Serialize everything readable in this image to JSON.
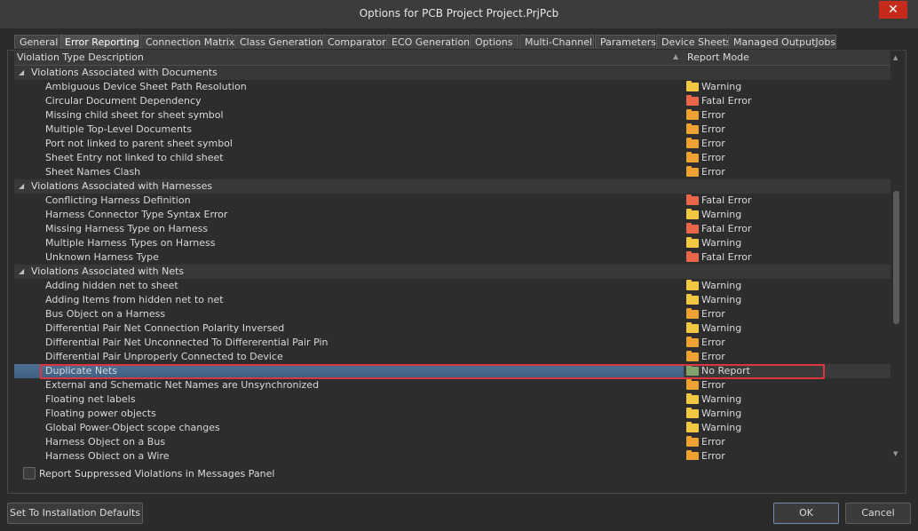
{
  "window": {
    "title": "Options for PCB Project Project.PrjPcb",
    "close_label": "✕"
  },
  "tabs": [
    {
      "label": "General",
      "width": 50
    },
    {
      "label": "Error Reporting",
      "width": 90,
      "active": true
    },
    {
      "label": "Connection Matrix",
      "width": 105
    },
    {
      "label": "Class Generation",
      "width": 98
    },
    {
      "label": "Comparator",
      "width": 71
    },
    {
      "label": "ECO Generation",
      "width": 93
    },
    {
      "label": "Options",
      "width": 55
    },
    {
      "label": "Multi-Channel",
      "width": 84
    },
    {
      "label": "Parameters",
      "width": 68
    },
    {
      "label": "Device Sheets",
      "width": 80
    },
    {
      "label": "Managed OutputJobs",
      "width": 122
    }
  ],
  "grid": {
    "col_description": "Violation Type Description",
    "col_mode": "Report Mode",
    "groups": [
      {
        "name": "Violations Associated with Documents",
        "items": [
          {
            "name": "Ambiguous Device Sheet Path Resolution",
            "mode": "Warning"
          },
          {
            "name": "Circular Document Dependency",
            "mode": "Fatal Error"
          },
          {
            "name": "Missing child sheet for sheet symbol",
            "mode": "Error"
          },
          {
            "name": "Multiple Top-Level Documents",
            "mode": "Error"
          },
          {
            "name": "Port not linked to parent sheet symbol",
            "mode": "Error"
          },
          {
            "name": "Sheet Entry not linked to child sheet",
            "mode": "Error"
          },
          {
            "name": "Sheet Names Clash",
            "mode": "Error"
          }
        ]
      },
      {
        "name": "Violations Associated with Harnesses",
        "items": [
          {
            "name": "Conflicting Harness Definition",
            "mode": "Fatal Error"
          },
          {
            "name": "Harness Connector Type Syntax Error",
            "mode": "Warning"
          },
          {
            "name": "Missing Harness Type on Harness",
            "mode": "Fatal Error"
          },
          {
            "name": "Multiple Harness Types on Harness",
            "mode": "Warning"
          },
          {
            "name": "Unknown Harness Type",
            "mode": "Fatal Error"
          }
        ]
      },
      {
        "name": "Violations Associated with Nets",
        "items": [
          {
            "name": "Adding hidden net to sheet",
            "mode": "Warning"
          },
          {
            "name": "Adding Items from hidden net to net",
            "mode": "Warning"
          },
          {
            "name": "Bus Object on a Harness",
            "mode": "Error"
          },
          {
            "name": "Differential Pair Net Connection Polarity Inversed",
            "mode": "Warning"
          },
          {
            "name": "Differential Pair Net Unconnected To Differerential Pair Pin",
            "mode": "Error"
          },
          {
            "name": "Differential Pair Unproperly Connected to Device",
            "mode": "Error"
          },
          {
            "name": "Duplicate Nets",
            "mode": "No Report",
            "selected": true
          },
          {
            "name": "External and Schematic Net Names are Unsynchronized",
            "mode": "Error"
          },
          {
            "name": "Floating net labels",
            "mode": "Warning"
          },
          {
            "name": "Floating power objects",
            "mode": "Warning"
          },
          {
            "name": "Global Power-Object scope changes",
            "mode": "Warning"
          },
          {
            "name": "Harness Object on a Bus",
            "mode": "Error"
          },
          {
            "name": "Harness Object on a Wire",
            "mode": "Error"
          }
        ]
      }
    ]
  },
  "mode_colors": {
    "Warning": "#f2c744",
    "Error": "#f0a030",
    "Fatal Error": "#e8664a",
    "No Report": "#7fa36a"
  },
  "options": {
    "report_suppressed_label": "Report Suppressed Violations in Messages Panel"
  },
  "buttons": {
    "defaults_label": "Set To Installation Defaults",
    "ok_label": "OK",
    "cancel_label": "Cancel"
  }
}
